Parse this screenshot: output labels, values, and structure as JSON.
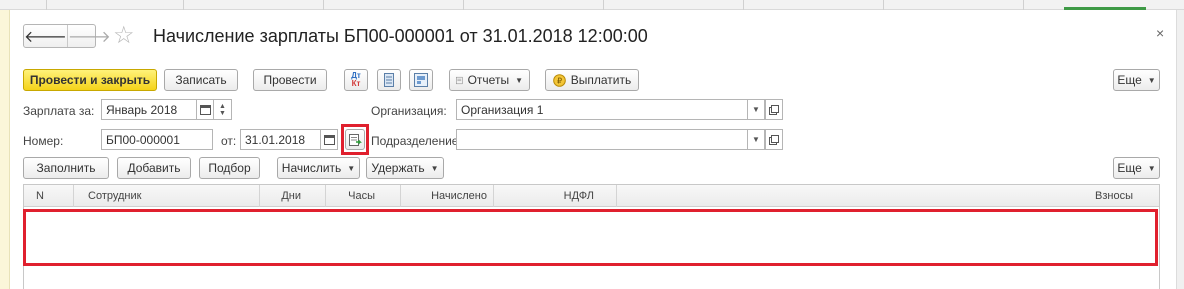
{
  "document": {
    "title": "Начисление зарплаты БП00-000001 от 31.01.2018 12:00:00",
    "close_glyph": "×"
  },
  "navigation": {
    "back_glyph": "🡐",
    "forward_glyph": "🡒"
  },
  "toolbar": {
    "post_close_label": "Провести и закрыть",
    "save_label": "Записать",
    "post_label": "Провести",
    "reports_label": "Отчеты",
    "pay_label": "Выплатить",
    "more_label": "Еще",
    "dt_kt_top": "Дт",
    "dt_kt_bottom": "Кт"
  },
  "form": {
    "salary_for_label": "Зарплата за:",
    "salary_for_value": "Январь 2018",
    "number_label": "Номер:",
    "number_value": "БП00-000001",
    "date_label": "от:",
    "date_value": "31.01.2018",
    "organization_label": "Организация:",
    "organization_value": "Организация 1",
    "division_label": "Подразделение:",
    "division_value": ""
  },
  "table_toolbar": {
    "fill_label": "Заполнить",
    "add_label": "Добавить",
    "select_label": "Подбор",
    "accrue_label": "Начислить",
    "withhold_label": "Удержать",
    "more_label": "Еще"
  },
  "table": {
    "columns": [
      "N",
      "Сотрудник",
      "Дни",
      "Часы",
      "Начислено",
      "НДФЛ",
      "Взносы"
    ],
    "rows": []
  },
  "colors": {
    "primary_button": "#f5d31a",
    "highlight": "#e0202e",
    "active_tab": "#3e9a46"
  }
}
